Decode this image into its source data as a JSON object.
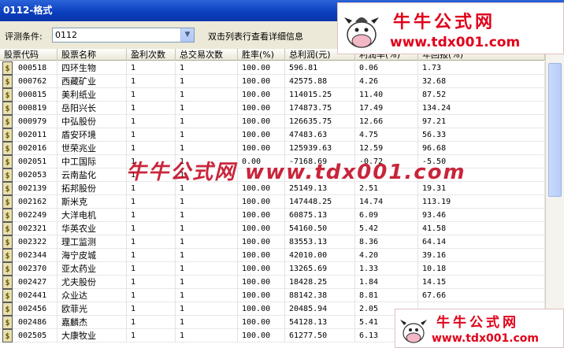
{
  "window": {
    "title": "0112-格式"
  },
  "filter": {
    "label": "评测条件:",
    "value": "0112",
    "hint": "双击列表行查看详细信息"
  },
  "columns": [
    "股票代码",
    "股票名称",
    "盈利次数",
    "总交易次数",
    "胜率(%)",
    "总利润(元)",
    "利润率(%)",
    "年回报(%)"
  ],
  "rows": [
    {
      "code": "000518",
      "name": "四环生物",
      "win": "1",
      "total": "1",
      "rate": "100.00",
      "profit": "596.81",
      "margin": "0.06",
      "annual": "1.73"
    },
    {
      "code": "000762",
      "name": "西藏矿业",
      "win": "1",
      "total": "1",
      "rate": "100.00",
      "profit": "42575.88",
      "margin": "4.26",
      "annual": "32.68"
    },
    {
      "code": "000815",
      "name": "美利纸业",
      "win": "1",
      "total": "1",
      "rate": "100.00",
      "profit": "114015.25",
      "margin": "11.40",
      "annual": "87.52"
    },
    {
      "code": "000819",
      "name": "岳阳兴长",
      "win": "1",
      "total": "1",
      "rate": "100.00",
      "profit": "174873.75",
      "margin": "17.49",
      "annual": "134.24"
    },
    {
      "code": "000979",
      "name": "中弘股份",
      "win": "1",
      "total": "1",
      "rate": "100.00",
      "profit": "126635.75",
      "margin": "12.66",
      "annual": "97.21"
    },
    {
      "code": "002011",
      "name": "盾安环境",
      "win": "1",
      "total": "1",
      "rate": "100.00",
      "profit": "47483.63",
      "margin": "4.75",
      "annual": "56.33"
    },
    {
      "code": "002016",
      "name": "世荣兆业",
      "win": "1",
      "total": "1",
      "rate": "100.00",
      "profit": "125939.63",
      "margin": "12.59",
      "annual": "96.68"
    },
    {
      "code": "002051",
      "name": "中工国际",
      "win": "1",
      "total": "1",
      "rate": "0.00",
      "profit": "-7168.69",
      "margin": "-0.72",
      "annual": "-5.50"
    },
    {
      "code": "002053",
      "name": "云南盐化",
      "win": "1",
      "total": "1",
      "rate": "",
      "profit": "",
      "margin": "",
      "annual": ""
    },
    {
      "code": "002139",
      "name": "拓邦股份",
      "win": "1",
      "total": "1",
      "rate": "100.00",
      "profit": "25149.13",
      "margin": "2.51",
      "annual": "19.31"
    },
    {
      "code": "002162",
      "name": "斯米克",
      "win": "1",
      "total": "1",
      "rate": "100.00",
      "profit": "147448.25",
      "margin": "14.74",
      "annual": "113.19"
    },
    {
      "code": "002249",
      "name": "大洋电机",
      "win": "1",
      "total": "1",
      "rate": "100.00",
      "profit": "60875.13",
      "margin": "6.09",
      "annual": "93.46"
    },
    {
      "code": "002321",
      "name": "华英农业",
      "win": "1",
      "total": "1",
      "rate": "100.00",
      "profit": "54160.50",
      "margin": "5.42",
      "annual": "41.58"
    },
    {
      "code": "002322",
      "name": "理工监测",
      "win": "1",
      "total": "1",
      "rate": "100.00",
      "profit": "83553.13",
      "margin": "8.36",
      "annual": "64.14"
    },
    {
      "code": "002344",
      "name": "海宁皮城",
      "win": "1",
      "total": "1",
      "rate": "100.00",
      "profit": "42010.00",
      "margin": "4.20",
      "annual": "39.16"
    },
    {
      "code": "002370",
      "name": "亚太药业",
      "win": "1",
      "total": "1",
      "rate": "100.00",
      "profit": "13265.69",
      "margin": "1.33",
      "annual": "10.18"
    },
    {
      "code": "002427",
      "name": "尤夫股份",
      "win": "1",
      "total": "1",
      "rate": "100.00",
      "profit": "18428.25",
      "margin": "1.84",
      "annual": "14.15"
    },
    {
      "code": "002441",
      "name": "众业达",
      "win": "1",
      "total": "1",
      "rate": "100.00",
      "profit": "88142.38",
      "margin": "8.81",
      "annual": "67.66"
    },
    {
      "code": "002456",
      "name": "欧菲光",
      "win": "1",
      "total": "1",
      "rate": "100.00",
      "profit": "20485.94",
      "margin": "2.05",
      "annual": ""
    },
    {
      "code": "002486",
      "name": "嘉麟杰",
      "win": "1",
      "total": "1",
      "rate": "100.00",
      "profit": "54128.13",
      "margin": "5.41",
      "annual": ""
    },
    {
      "code": "002505",
      "name": "大康牧业",
      "win": "1",
      "total": "1",
      "rate": "100.00",
      "profit": "61277.50",
      "margin": "6.13",
      "annual": ""
    }
  ],
  "watermark": {
    "title": "牛牛公式网",
    "url": "www.tdx001.com",
    "center": "牛牛公式网 www.tdx001.com"
  }
}
